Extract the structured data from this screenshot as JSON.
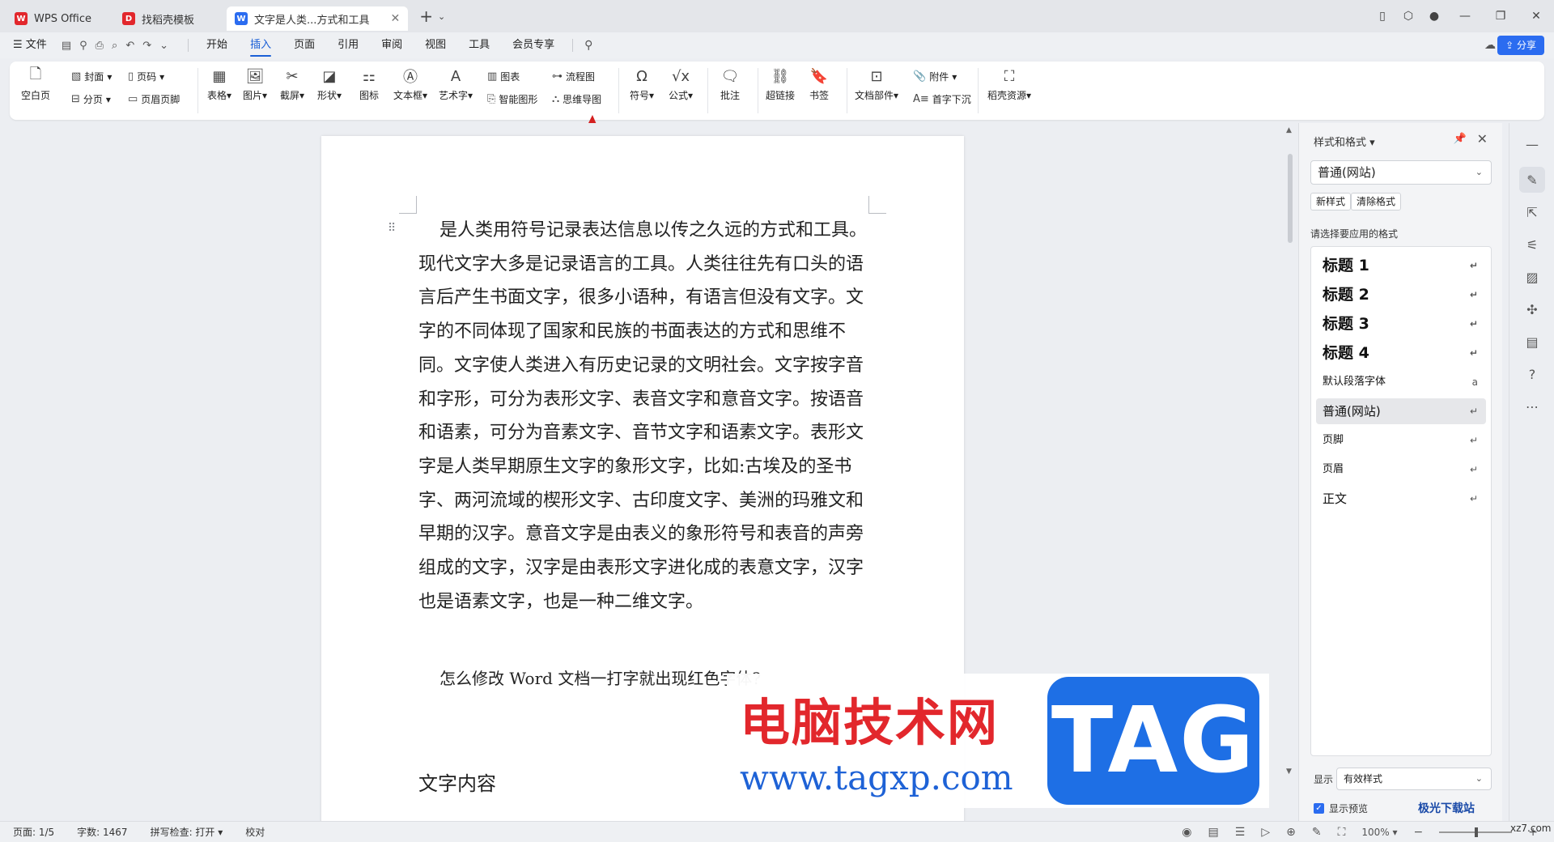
{
  "titlebar": {
    "tabs": [
      {
        "label": "WPS Office",
        "icon": "wps-logo-icon",
        "color": "#e2272c"
      },
      {
        "label": "找稻壳模板",
        "icon": "docer-icon",
        "color": "#e2272c"
      },
      {
        "label": "文字是人类...方式和工具",
        "icon": "word-doc-icon",
        "color": "#2b6cf0"
      }
    ]
  },
  "menubar": {
    "file": "文件",
    "items": [
      "开始",
      "插入",
      "页面",
      "引用",
      "审阅",
      "视图",
      "工具",
      "会员专享"
    ],
    "active": "插入",
    "share": "分享"
  },
  "ribbon": {
    "blank_page": "空白页",
    "cover": "封面",
    "page_break": "分页",
    "page_num": "页码",
    "header_footer": "页眉页脚",
    "table": "表格",
    "picture": "图片",
    "screenshot": "截屏",
    "shape": "形状",
    "icon": "图标",
    "textbox": "文本框",
    "wordart": "艺术字",
    "chart": "图表",
    "smartart": "智能图形",
    "flowchart": "流程图",
    "mindmap": "思维导图",
    "symbol": "符号",
    "formula": "公式",
    "comment": "批注",
    "hyperlink": "超链接",
    "bookmark": "书签",
    "doc_parts": "文档部件",
    "attachment": "附件",
    "dropcap": "首字下沉",
    "docer_res": "稻壳资源"
  },
  "document": {
    "paragraph1": "是人类用符号记录表达信息以传之久远的方式和工具。现代文字大多是记录语言的工具。人类往往先有口头的语言后产生书面文字，很多小语种，有语言但没有文字。文字的不同体现了国家和民族的书面表达的方式和思维不同。文字使人类进入有历史记录的文明社会。文字按字音和字形，可分为表形文字、表音文字和意音文字。按语音和语素，可分为音素文字、音节文字和语素文字。表形文字是人类早期原生文字的象形文字，比如:古埃及的圣书字、两河流域的楔形文字、古印度文字、美洲的玛雅文和早期的汉字。意音文字是由表义的象形符号和表音的声旁组成的文字，汉字是由表形文字进化成的表意文字，汉字也是语素文字，也是一种二维文字。",
    "paragraph2": "怎么修改 Word 文档一打字就出现红色字体?",
    "heading": "文字内容"
  },
  "styles_panel": {
    "title": "样式和格式",
    "current": "普通(网站)",
    "new_style": "新样式",
    "clear_format": "清除格式",
    "prompt": "请选择要应用的格式",
    "items": [
      {
        "label": "标题  1",
        "kind": "heading"
      },
      {
        "label": "标题  2",
        "kind": "heading"
      },
      {
        "label": "标题  3",
        "kind": "heading"
      },
      {
        "label": "标题 4",
        "kind": "heading"
      },
      {
        "label": "默认段落字体",
        "kind": "small"
      },
      {
        "label": "普通(网站)",
        "kind": "selected"
      },
      {
        "label": "页脚",
        "kind": "small"
      },
      {
        "label": "页眉",
        "kind": "small"
      },
      {
        "label": "正文",
        "kind": "normal"
      }
    ],
    "show_label": "显示",
    "show_value": "有效样式",
    "preview_label": "显示预览"
  },
  "statusbar": {
    "page": "页面: 1/5",
    "words": "字数: 1467",
    "spell": "拼写检查: 打开",
    "proof": "校对",
    "zoom": "100%"
  },
  "watermark": {
    "cn": "电脑技术网",
    "url": "www.tagxp.com",
    "tag": "TAG",
    "site2": "极光下载站",
    "site2b": "xz7.com"
  },
  "colors": {
    "accent": "#2b6cf0",
    "arrow": "#d42020",
    "watermark_red": "#e2272c"
  }
}
